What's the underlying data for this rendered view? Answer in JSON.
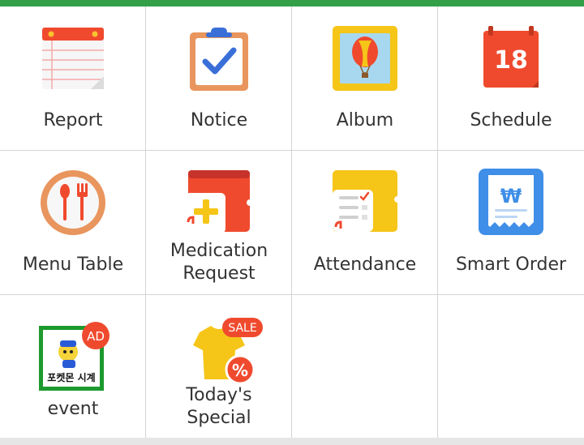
{
  "menu": {
    "items": [
      {
        "label": "Report",
        "icon": "notepad-icon"
      },
      {
        "label": "Notice",
        "icon": "clipboard-check-icon"
      },
      {
        "label": "Album",
        "icon": "balloon-photo-icon"
      },
      {
        "label": "Schedule",
        "icon": "calendar-icon",
        "date": "18"
      },
      {
        "label": "Menu Table",
        "icon": "plate-spoon-fork-icon"
      },
      {
        "label_line1": "Medication",
        "label_line2": "Request",
        "icon": "medical-folder-icon"
      },
      {
        "label": "Attendance",
        "icon": "attendance-checklist-icon"
      },
      {
        "label": "Smart Order",
        "icon": "won-receipt-icon",
        "symbol": "₩"
      },
      {
        "label": "event",
        "icon": "ad-banner-icon",
        "badge": "AD",
        "banner_text": "포켓몬 시계"
      },
      {
        "label_line1": "Today's",
        "label_line2": "Special",
        "icon": "tshirt-sale-icon",
        "badge": "SALE",
        "symbol": "%"
      }
    ]
  },
  "colors": {
    "top_bar": "#33a048",
    "grid_line": "#d4d4d4",
    "label_text": "#333333"
  }
}
